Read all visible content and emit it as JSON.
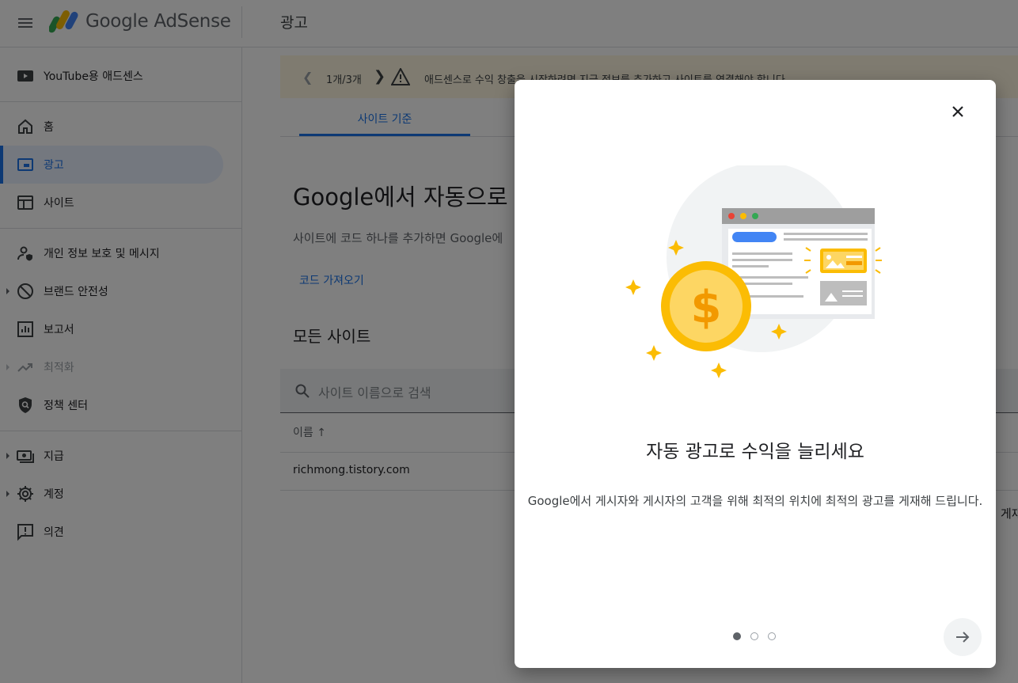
{
  "header": {
    "brand": "Google AdSense",
    "page_title": "광고"
  },
  "sidebar": {
    "items": [
      {
        "label": "YouTube용 애드센스",
        "icon": "youtube-icon"
      },
      {
        "label": "홈",
        "icon": "home-icon"
      },
      {
        "label": "광고",
        "icon": "ads-icon",
        "active": true
      },
      {
        "label": "사이트",
        "icon": "sites-icon"
      },
      {
        "label": "개인 정보 보호 및 메시지",
        "icon": "privacy-icon"
      },
      {
        "label": "브랜드 안전성",
        "icon": "block-icon"
      },
      {
        "label": "보고서",
        "icon": "reports-icon"
      },
      {
        "label": "최적화",
        "icon": "trending-icon",
        "disabled": true
      },
      {
        "label": "정책 센터",
        "icon": "policy-shield-icon"
      },
      {
        "label": "지급",
        "icon": "payments-icon"
      },
      {
        "label": "계정",
        "icon": "gear-icon"
      },
      {
        "label": "의견",
        "icon": "feedback-icon"
      }
    ]
  },
  "main": {
    "alert": {
      "counter": "1개/3개",
      "message": "애드센스로 수익 창출을 시작하려면 지급 정보를 추가하고 사이트를 연결해야 합니다."
    },
    "tab": "사이트 기준",
    "heading": "Google에서 자동으로 크",
    "subheading": "사이트에 코드 하나를 추가하면 Google에",
    "get_code": "코드 가져오기",
    "all_sites": "모든 사이트",
    "search_placeholder": "사이트 이름으로 검색",
    "column_name": "이름",
    "rows": [
      "richmong.tistory.com"
    ],
    "edge_text": "게재 중"
  },
  "dialog": {
    "title": "자동 광고로 수익을 늘리세요",
    "body": "Google에서 게시자와 게시자의 고객을 위해 최적의 위치에 최적의 광고를 게재해 드립니다.",
    "step": {
      "current": 1,
      "total": 3
    },
    "colors": {
      "coin": "#fbbc04",
      "accent": "#1a73e8"
    }
  }
}
